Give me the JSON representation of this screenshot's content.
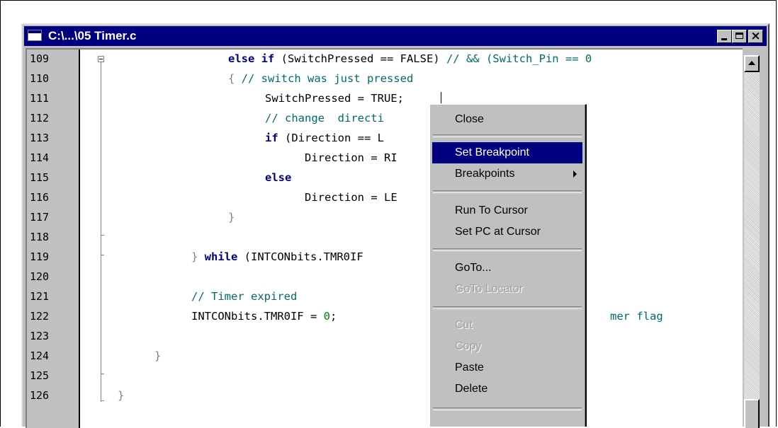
{
  "window": {
    "title": "C:\\...\\05 Timer.c",
    "minimize": "_",
    "maximize": "□",
    "close": "×"
  },
  "editor": {
    "line_numbers": [
      "109",
      "110",
      "111",
      "112",
      "113",
      "114",
      "115",
      "116",
      "117",
      "118",
      "119",
      "120",
      "121",
      "122",
      "123",
      "124",
      "125",
      "126"
    ],
    "lines": {
      "l109": {
        "kw1": "else if",
        "rest": " (SwitchPressed == FALSE) ",
        "cm": "// && (Switch_Pin == 0"
      },
      "l110": {
        "gr": "{ ",
        "cm": "// switch was just pressed"
      },
      "l111": {
        "text": "SwitchPressed = TRUE;"
      },
      "l112": {
        "cm": "// change  directi"
      },
      "l113": {
        "kw": "if",
        "rest": " (Direction == L"
      },
      "l114": {
        "text": "Direction = RI"
      },
      "l115": {
        "kw": "else"
      },
      "l116": {
        "text": "Direction = LE"
      },
      "l117": {
        "gr": "}"
      },
      "l119": {
        "gr": "} ",
        "kw": "while",
        "rest": " (INTCONbits.TMR0IF"
      },
      "l121": {
        "cm": "// Timer expired"
      },
      "l122": {
        "text": "INTCONbits.TMR0IF = ",
        "num": "0",
        "semi": ";",
        "tail": "mer flag"
      },
      "l124": {
        "gr": "}"
      },
      "l126": {
        "gr": "}"
      }
    }
  },
  "context_menu": {
    "items": {
      "close": "Close",
      "set_breakpoint": "Set Breakpoint",
      "breakpoints": "Breakpoints",
      "run_to_cursor": "Run To Cursor",
      "set_pc_at_cursor": "Set PC at Cursor",
      "goto": "GoTo...",
      "goto_locator": "GoTo Locator",
      "cut": "Cut",
      "copy": "Copy",
      "paste": "Paste",
      "delete": "Delete"
    },
    "selected": "Set Breakpoint",
    "disabled": [
      "GoTo Locator",
      "Cut",
      "Copy"
    ]
  },
  "colors": {
    "titlebar": "#000080",
    "keyword": "#000080",
    "comment": "#006b6b",
    "number": "#008000",
    "menu_highlight": "#000080"
  }
}
